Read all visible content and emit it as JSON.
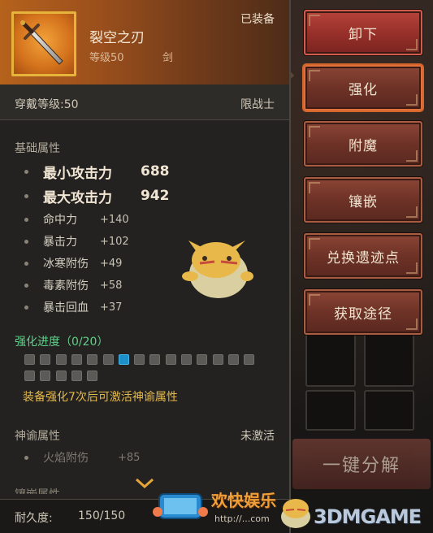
{
  "item": {
    "name": "裂空之刃",
    "level_label": "等级50",
    "type_label": "剑",
    "equipped_tag": "已装备",
    "required_level": "穿戴等级:50",
    "class_restriction": "限战士",
    "icon": "sword-icon"
  },
  "base_attributes": {
    "title": "基础属性",
    "items": [
      {
        "name": "最小攻击力",
        "value": "688",
        "major": true
      },
      {
        "name": "最大攻击力",
        "value": "942",
        "major": true
      },
      {
        "name": "命中力",
        "value": "+140",
        "major": false
      },
      {
        "name": "暴击力",
        "value": "+102",
        "major": false
      },
      {
        "name": "冰寒附伤",
        "value": "+49",
        "major": false
      },
      {
        "name": "毒素附伤",
        "value": "+58",
        "major": false
      },
      {
        "name": "暴击回血",
        "value": "+37",
        "major": false
      }
    ]
  },
  "enhance": {
    "title": "强化进度（0/20）",
    "total_pips": 20,
    "lit_pip_index": 6,
    "hint": "装备强化7次后可激活神谕属性",
    "colors": {
      "pip": "#5b5a56",
      "lit": "#1d8fc9",
      "title": "#5fd08a",
      "hint": "#e4b94c"
    }
  },
  "divine": {
    "title": "神谕属性",
    "status": "未激活",
    "attr_name": "火焰附伤",
    "attr_value": "+85"
  },
  "inlay_title_partial": "镶嵌属性",
  "durability": {
    "label": "耐久度:",
    "value": "150/150"
  },
  "actions": {
    "unequip": "卸下",
    "enhance": "强化",
    "enchant": "附魔",
    "inlay": "镶嵌",
    "exchange": "兑换遗迹点",
    "obtain": "获取途径"
  },
  "background": {
    "disassemble_banner": "一键分解"
  },
  "watermark": {
    "cn_text": "欢快娱乐",
    "url": "http://...com",
    "brand": "3DMGAME"
  }
}
